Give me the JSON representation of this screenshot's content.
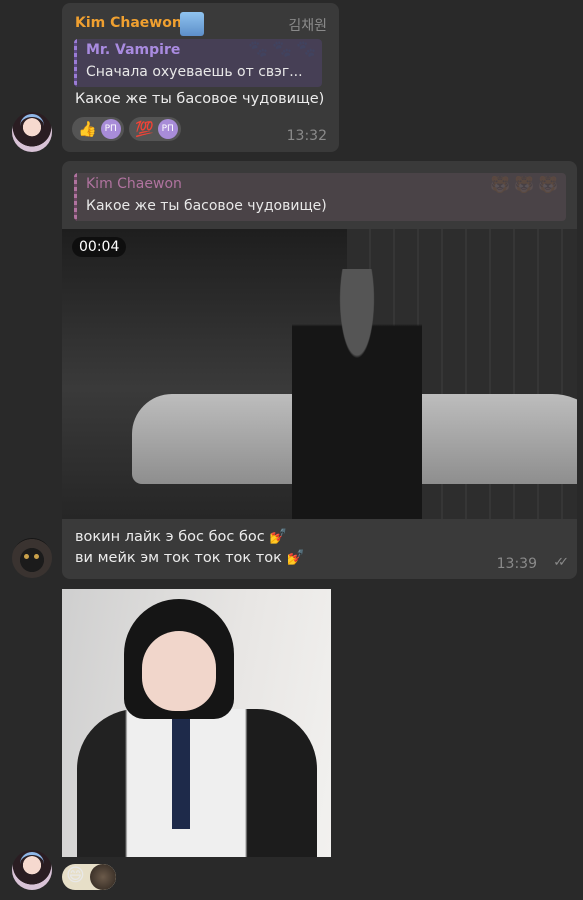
{
  "colors": {
    "background": "#292929",
    "bubble": "#3a3a3a",
    "sender_name": "#f0a030",
    "reply_purple": "#9b7cd6",
    "reply_pink": "#b0739f"
  },
  "messages": [
    {
      "sender": "Kim Chaewon",
      "sender_badge_icon": "idol-figure-icon",
      "sender_tag": "김채원",
      "reply": {
        "name": "Mr. Vampire",
        "text": "Сначала охуеваешь от свэг..."
      },
      "text": "Какое же ты басовое чудовище)",
      "reactions": [
        {
          "emoji": "👍",
          "avatar": "РП"
        },
        {
          "emoji": "💯",
          "avatar": "РП"
        }
      ],
      "time": "13:32"
    },
    {
      "reply": {
        "name": "Kim Chaewon",
        "text": "Какое же ты басовое чудовище)"
      },
      "video_duration": "00:04",
      "text_lines": [
        "вокин лайк э бос бос бос 💅",
        "ви мейк эм ток ток ток ток 💅"
      ],
      "time": "13:39",
      "status_icon": "double-check-icon"
    },
    {
      "media": "photo",
      "sticker_emoji": "😄"
    }
  ]
}
